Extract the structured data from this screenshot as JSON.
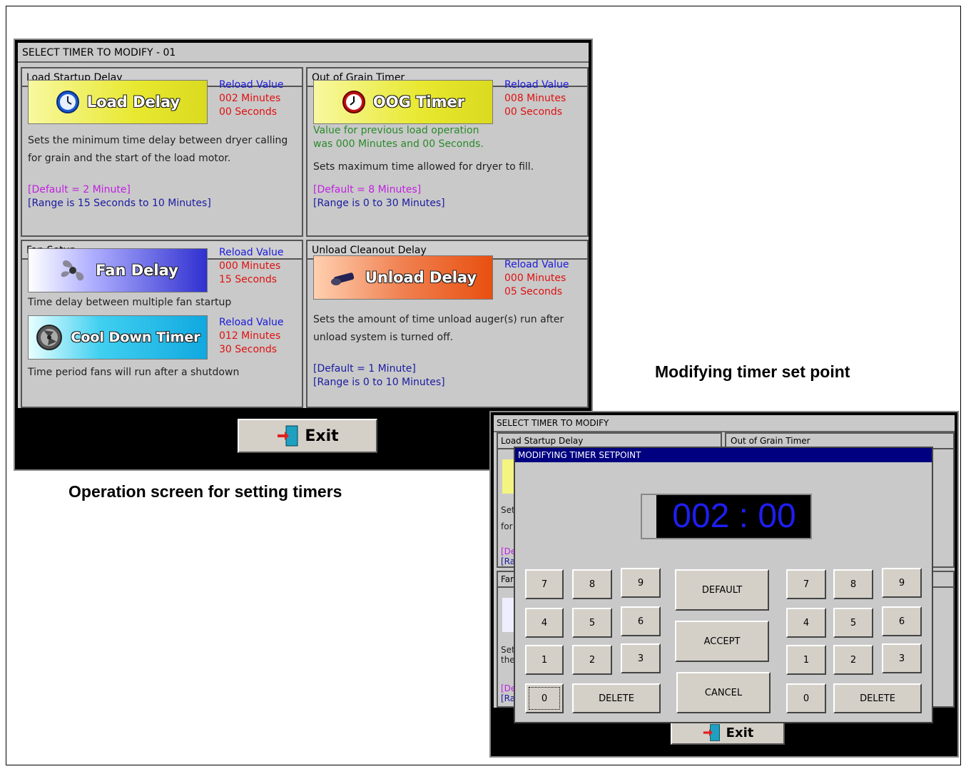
{
  "main": {
    "title": "SELECT TIMER TO MODIFY - 01",
    "load": {
      "header": "Load Startup Delay",
      "button": "Load Delay",
      "reload_label": "Reload Value",
      "minutes": "002 Minutes",
      "seconds": "00 Seconds",
      "desc1": "Sets the minimum time delay between dryer calling",
      "desc2": "for grain and the start of the load motor.",
      "default": "[Default = 2 Minute]",
      "range": "[Range is 15 Seconds to 10 Minutes]"
    },
    "oog": {
      "header": "Out of Grain Timer",
      "button": "OOG Timer",
      "reload_label": "Reload Value",
      "minutes": "008 Minutes",
      "seconds": "00 Seconds",
      "prev1": "Value for previous load operation",
      "prev2": "was 000 Minutes and 00 Seconds.",
      "desc": "Sets maximum time allowed for dryer to fill.",
      "default": "[Default = 8 Minutes]",
      "range": "[Range is 0 to 30 Minutes]"
    },
    "fan": {
      "header": "Fan Setup",
      "button": "Fan Delay",
      "reload_label": "Reload Value",
      "minutes": "000 Minutes",
      "seconds": "15 Seconds",
      "desc": "Time delay between multiple fan startup",
      "cool_button": "Cool Down Timer",
      "cool_reload_label": "Reload Value",
      "cool_minutes": "012 Minutes",
      "cool_seconds": "30 Seconds",
      "cool_desc": "Time period fans will run after a shutdown"
    },
    "unload": {
      "header": "Unload Cleanout Delay",
      "button": "Unload Delay",
      "reload_label": "Reload Value",
      "minutes": "000 Minutes",
      "seconds": "05 Seconds",
      "desc1": "Sets the amount of time unload auger(s) run after",
      "desc2": "unload system is turned off.",
      "default": "[Default = 1 Minute]",
      "range": "[Range is 0 to 10 Minutes]"
    },
    "exit": "Exit"
  },
  "captions": {
    "left": "Operation screen for setting timers",
    "right": "Modifying timer set point"
  },
  "second": {
    "title": "SELECT TIMER TO MODIFY",
    "panel1": "Load Startup Delay",
    "panel2": "Out of Grain Timer",
    "frag": [
      "Set",
      "for",
      "[De",
      "[Ra",
      "Far",
      "Set",
      "the",
      "[De",
      "[Ra"
    ],
    "exit": "Exit",
    "dialog": {
      "title": "MODIFYING TIMER SETPOINT",
      "display": "002 : 00",
      "keys": [
        "7",
        "8",
        "9",
        "4",
        "5",
        "6",
        "1",
        "2",
        "3",
        "0"
      ],
      "delete": "DELETE",
      "default": "DEFAULT",
      "accept": "ACCEPT",
      "cancel": "CANCEL"
    }
  },
  "colors": {
    "dialog_title": "#000080",
    "display_digits": "#1e1ef0",
    "reload_label": "#1a1adb",
    "reload_value": "#e01010"
  }
}
